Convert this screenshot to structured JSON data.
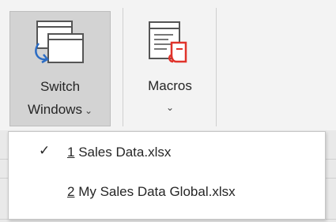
{
  "ribbon": {
    "switch_windows": {
      "line1": "Switch",
      "line2": "Windows",
      "chevron": "⌄",
      "icon": "switch-windows-icon"
    },
    "macros": {
      "label": "Macros",
      "chevron": "⌄",
      "icon": "macros-icon"
    }
  },
  "menu": {
    "items": [
      {
        "number": "1",
        "label": " Sales Data.xlsx",
        "checked": true,
        "check_glyph": "✓"
      },
      {
        "number": "2",
        "label": " My Sales Data Global.xlsx",
        "checked": false,
        "check_glyph": ""
      }
    ]
  },
  "colors": {
    "pressed_bg": "#d3d3d3",
    "accent_blue": "#2b6cc4",
    "macro_red": "#e0332b"
  }
}
